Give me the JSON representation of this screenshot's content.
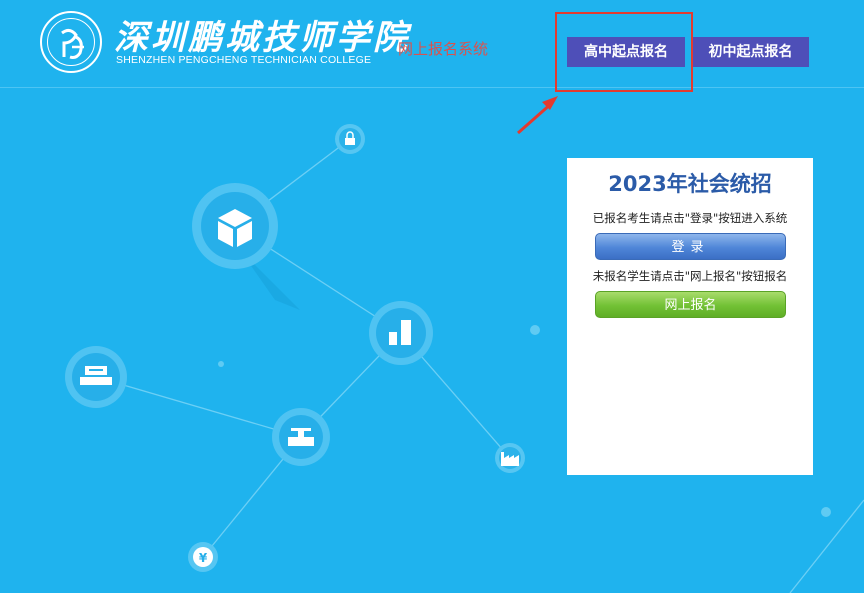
{
  "header": {
    "school_name_cn": "深圳鹏城技师学院",
    "school_name_en": "SHENZHEN PENGCHENG TECHNICIAN COLLEGE",
    "system_name": "网上报名系统"
  },
  "nav": {
    "high_school_label": "高中起点报名",
    "middle_school_label": "初中起点报名"
  },
  "panel": {
    "title": "2023年社会统招",
    "registered_hint": "已报名考生请点击\"登录\"按钮进入系统",
    "login_label": "登录",
    "unregistered_hint": "未报名学生请点击\"网上报名\"按钮报名",
    "register_label": "网上报名"
  },
  "network_icons": [
    "lock-icon",
    "cube-icon",
    "bar-chart-icon",
    "printer-icon",
    "stamp-icon",
    "factory-icon",
    "yen-icon"
  ],
  "colors": {
    "background": "#1fb3ee",
    "nav_button": "#4e4fb8",
    "annotation_red": "#e43a2f",
    "system_name": "#d9534f",
    "panel_title": "#2b5ba8",
    "login_blue": "#4f86d8",
    "register_green": "#72c135"
  }
}
